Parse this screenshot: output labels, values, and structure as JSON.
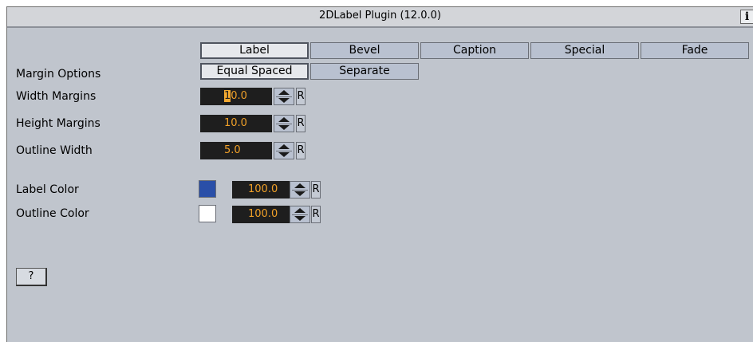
{
  "window": {
    "title": "2DLabel Plugin (12.0.0)",
    "info_icon": "i"
  },
  "tabs": [
    {
      "label": "Label",
      "active": true
    },
    {
      "label": "Bevel",
      "active": false
    },
    {
      "label": "Caption",
      "active": false
    },
    {
      "label": "Special",
      "active": false
    },
    {
      "label": "Fade",
      "active": false
    }
  ],
  "margin_options": {
    "label": "Margin Options",
    "equal_spaced": "Equal Spaced",
    "separate": "Separate",
    "selected": "Equal Spaced"
  },
  "width_margins": {
    "label": "Width Margins",
    "value_caret": "1",
    "value_rest": "0.0",
    "reset": "R"
  },
  "height_margins": {
    "label": "Height Margins",
    "value": "10.0",
    "reset": "R"
  },
  "outline_width": {
    "label": "Outline Width",
    "value": "5.0",
    "reset": "R"
  },
  "label_color": {
    "label": "Label Color",
    "value": "100.0",
    "reset": "R",
    "swatch_color": "#2a4fa8"
  },
  "outline_color": {
    "label": "Outline Color",
    "value": "100.0",
    "reset": "R",
    "swatch_color": "#ffffff"
  },
  "help_button": "?",
  "colors": {
    "panel": "#c0c5cd",
    "field_bg": "#1e1e1e",
    "field_text": "#f0a028",
    "button": "#b9c1d0"
  }
}
